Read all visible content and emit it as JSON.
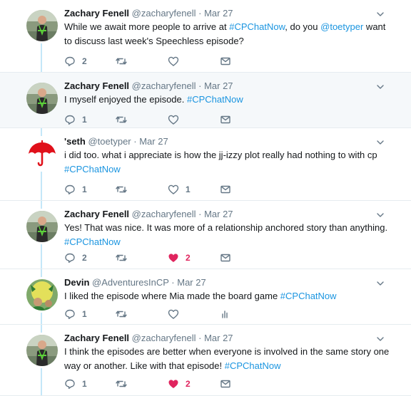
{
  "tweets": [
    {
      "name": "Zachary Fenell",
      "handle": "@zacharyfenell",
      "separator": "·",
      "time": "Mar 27",
      "text_parts": [
        {
          "t": "While we await more people to arrive at ",
          "k": "plain"
        },
        {
          "t": "#CPChatNow",
          "k": "hashtag"
        },
        {
          "t": ", do you ",
          "k": "plain"
        },
        {
          "t": "@toetyper",
          "k": "mention"
        },
        {
          "t": " want to discuss last week's Speechless episode?",
          "k": "plain"
        }
      ],
      "reply_count": "2",
      "retweet_count": "",
      "like_count": "",
      "liked": false,
      "last_action": "mail-icon",
      "avatar": "zachary"
    },
    {
      "name": "Zachary Fenell",
      "handle": "@zacharyfenell",
      "separator": "·",
      "time": "Mar 27",
      "text_parts": [
        {
          "t": "I myself enjoyed the episode. ",
          "k": "plain"
        },
        {
          "t": "#CPChatNow",
          "k": "hashtag"
        }
      ],
      "reply_count": "1",
      "retweet_count": "",
      "like_count": "",
      "liked": false,
      "last_action": "mail-icon",
      "avatar": "zachary"
    },
    {
      "name": "'seth",
      "handle": "@toetyper",
      "separator": "·",
      "time": "Mar 27",
      "text_parts": [
        {
          "t": "i did too.  what i appreciate is how the jj-izzy plot really had nothing to with cp ",
          "k": "plain"
        },
        {
          "t": "#CPChatNow",
          "k": "hashtag"
        }
      ],
      "reply_count": "1",
      "retweet_count": "",
      "like_count": "1",
      "liked": false,
      "last_action": "mail-icon",
      "avatar": "umbrella"
    },
    {
      "name": "Zachary Fenell",
      "handle": "@zacharyfenell",
      "separator": "·",
      "time": "Mar 27",
      "text_parts": [
        {
          "t": "Yes! That was nice. It was more of a relationship anchored story than anything. ",
          "k": "plain"
        },
        {
          "t": "#CPChatNow",
          "k": "hashtag"
        }
      ],
      "reply_count": "2",
      "retweet_count": "",
      "like_count": "2",
      "liked": true,
      "last_action": "mail-icon",
      "avatar": "zachary"
    },
    {
      "name": "Devin",
      "handle": "@AdventuresInCP",
      "separator": "·",
      "time": "Mar 27",
      "text_parts": [
        {
          "t": "I liked the episode where Mia made the board game ",
          "k": "plain"
        },
        {
          "t": "#CPChatNow",
          "k": "hashtag"
        }
      ],
      "reply_count": "1",
      "retweet_count": "",
      "like_count": "",
      "liked": false,
      "last_action": "analytics-icon",
      "avatar": "devin"
    },
    {
      "name": "Zachary Fenell",
      "handle": "@zacharyfenell",
      "separator": "·",
      "time": "Mar 27",
      "text_parts": [
        {
          "t": "I think the episodes are better when everyone is involved in the same story one way or another. Like with that episode! ",
          "k": "plain"
        },
        {
          "t": "#CPChatNow",
          "k": "hashtag"
        }
      ],
      "reply_count": "1",
      "retweet_count": "",
      "like_count": "2",
      "liked": true,
      "last_action": "mail-icon",
      "avatar": "zachary"
    }
  ],
  "colors": {
    "hashtag": "#1b95e0",
    "like": "#e0245e",
    "muted": "#657786",
    "thread_line": "#c4e7f8",
    "highlight_bg": "#f5f8fa",
    "umbrella": "#e0101a"
  }
}
